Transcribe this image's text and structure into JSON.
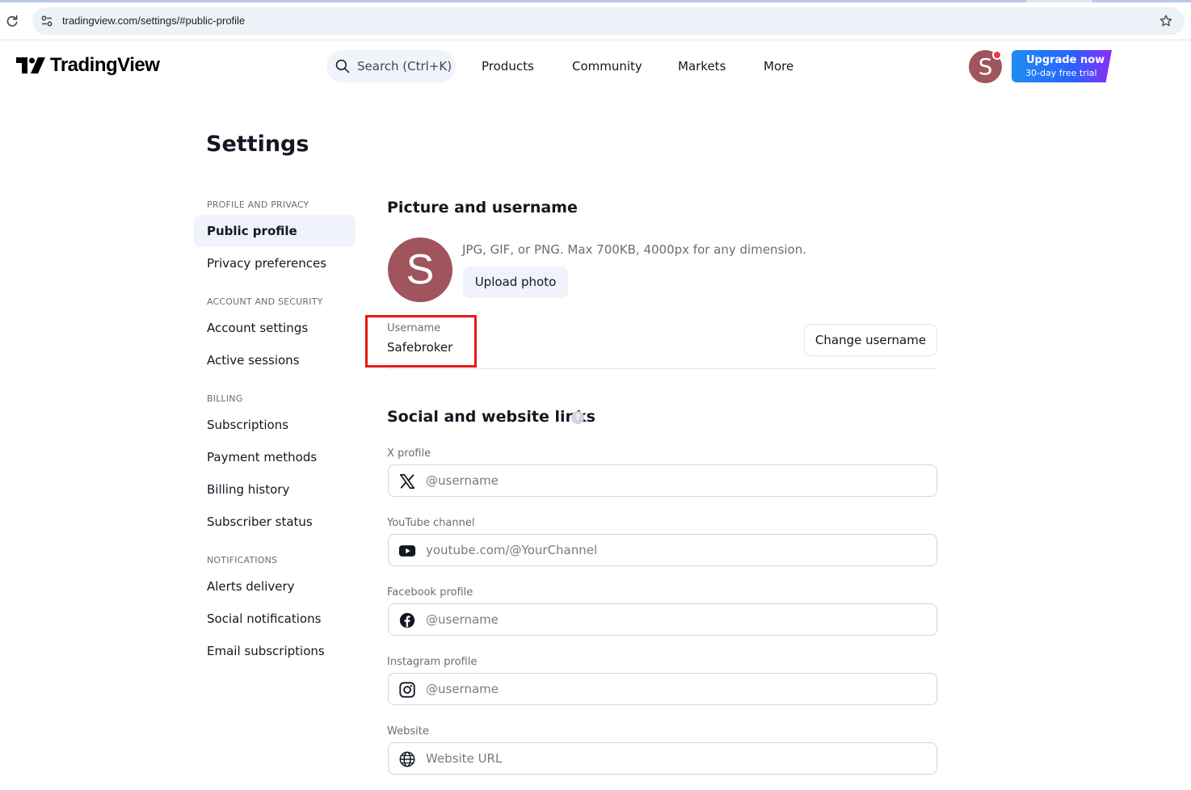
{
  "browser": {
    "url": "tradingview.com/settings/#public-profile"
  },
  "header": {
    "logo_text": "TradingView",
    "search_label": "Search (Ctrl+K)",
    "nav": [
      "Products",
      "Community",
      "Markets",
      "More"
    ],
    "avatar_letter": "S",
    "upgrade_main": "Upgrade now",
    "upgrade_sub": "30-day free trial"
  },
  "page": {
    "title": "Settings"
  },
  "sidebar": {
    "sections": [
      {
        "title": "PROFILE AND PRIVACY",
        "items": [
          "Public profile",
          "Privacy preferences"
        ]
      },
      {
        "title": "ACCOUNT AND SECURITY",
        "items": [
          "Account settings",
          "Active sessions"
        ]
      },
      {
        "title": "BILLING",
        "items": [
          "Subscriptions",
          "Payment methods",
          "Billing history",
          "Subscriber status"
        ]
      },
      {
        "title": "NOTIFICATIONS",
        "items": [
          "Alerts delivery",
          "Social notifications",
          "Email subscriptions"
        ]
      }
    ],
    "active_item": "Public profile"
  },
  "profile": {
    "section_title": "Picture and username",
    "avatar_letter": "S",
    "photo_hint": "JPG, GIF, or PNG. Max 700KB, 4000px for any dimension.",
    "upload_label": "Upload photo",
    "username_label": "Username",
    "username_value": "Safebroker",
    "change_username_label": "Change username"
  },
  "social": {
    "section_title": "Social and website links",
    "help_symbol": "?",
    "fields": [
      {
        "label": "X profile",
        "placeholder": "@username",
        "icon": "x-icon"
      },
      {
        "label": "YouTube channel",
        "placeholder": "youtube.com/@YourChannel",
        "icon": "youtube-icon"
      },
      {
        "label": "Facebook profile",
        "placeholder": "@username",
        "icon": "facebook-icon"
      },
      {
        "label": "Instagram profile",
        "placeholder": "@username",
        "icon": "instagram-icon"
      },
      {
        "label": "Website",
        "placeholder": "Website URL",
        "icon": "globe-icon"
      }
    ]
  },
  "colors": {
    "avatar": "#a0545c",
    "highlight_border": "#e51a1a",
    "accent": "#2962ff"
  }
}
